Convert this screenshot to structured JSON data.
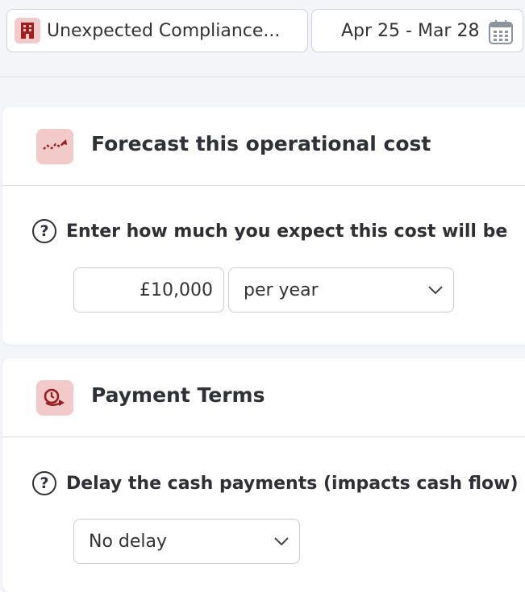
{
  "toolbar": {
    "entity_label": "Unexpected Compliance...",
    "entity_icon": "building-icon",
    "date_range": "Apr 25 - Mar 28",
    "calendar_icon": "calendar-icon"
  },
  "forecast": {
    "title": "Forecast this operational cost",
    "icon": "trend-up-icon",
    "question": "Enter how much you expect this cost will be",
    "amount": "£10,000",
    "period": "per year"
  },
  "payment": {
    "title": "Payment Terms",
    "icon": "payment-delay-icon",
    "question": "Delay the cash payments (impacts cash flow)",
    "delay": "No delay"
  },
  "colors": {
    "accent_bg": "#f3caca",
    "accent": "#9b1c1c",
    "page_bg": "#f3f5f8"
  }
}
